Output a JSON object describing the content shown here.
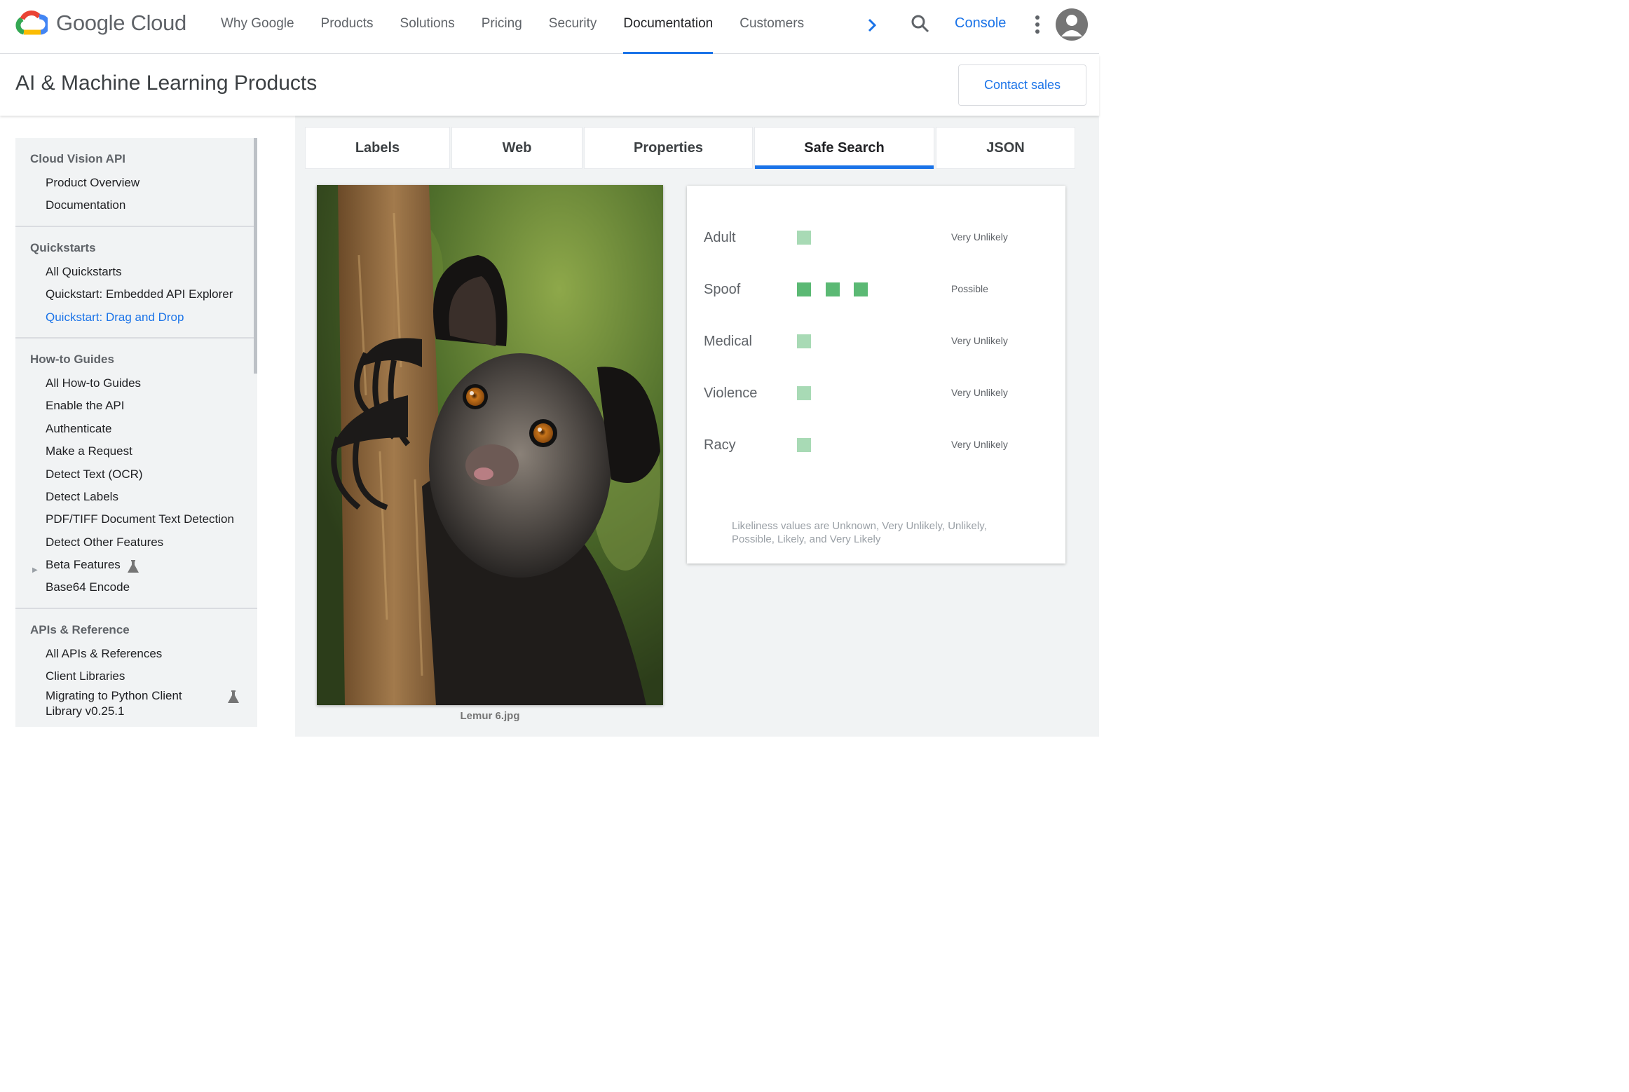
{
  "header": {
    "brand": "Google Cloud",
    "nav": [
      "Why Google",
      "Products",
      "Solutions",
      "Pricing",
      "Security",
      "Documentation",
      "Customers"
    ],
    "active_nav": "Documentation",
    "console_label": "Console",
    "icons": [
      "google-cloud-logo",
      "chevron-right-icon",
      "search-icon",
      "more-vert-icon",
      "account-icon"
    ]
  },
  "subheader": {
    "title": "AI & Machine Learning Products",
    "contact_label": "Contact sales"
  },
  "sidebar": {
    "sections": [
      {
        "title": "Cloud Vision API",
        "items": [
          "Product Overview",
          "Documentation"
        ]
      },
      {
        "title": "Quickstarts",
        "items": [
          "All Quickstarts",
          "Quickstart: Embedded API Explorer",
          "Quickstart: Drag and Drop"
        ]
      },
      {
        "title": "How-to Guides",
        "items": [
          "All How-to Guides",
          "Enable the API",
          "Authenticate",
          "Make a Request",
          "Detect Text (OCR)",
          "Detect Labels",
          "PDF/TIFF Document Text Detection",
          "Detect Other Features",
          "Beta Features",
          "Base64 Encode"
        ]
      },
      {
        "title": "APIs & Reference",
        "items": [
          "All APIs & References",
          "Client Libraries",
          "Migrating to Python Client Library v0.25.1"
        ]
      }
    ],
    "active_item": "Quickstart: Drag and Drop"
  },
  "tabs": [
    "Labels",
    "Web",
    "Properties",
    "Safe Search",
    "JSON"
  ],
  "active_tab": "Safe Search",
  "image": {
    "caption": "Lemur 6.jpg"
  },
  "safe_search": {
    "rows": [
      {
        "label": "Adult",
        "value": "Very Unlikely",
        "level": 1
      },
      {
        "label": "Spoof",
        "value": "Possible",
        "level": 3
      },
      {
        "label": "Medical",
        "value": "Very Unlikely",
        "level": 1
      },
      {
        "label": "Violence",
        "value": "Very Unlikely",
        "level": 1
      },
      {
        "label": "Racy",
        "value": "Very Unlikely",
        "level": 1
      }
    ],
    "note": "Likeliness values are Unknown, Very Unlikely, Unlikely, Possible, Likely, and Very Likely"
  },
  "colors": {
    "accent": "#1a73e8",
    "bar_strong": "#5bb974",
    "bar_light": "#a8dab5"
  }
}
